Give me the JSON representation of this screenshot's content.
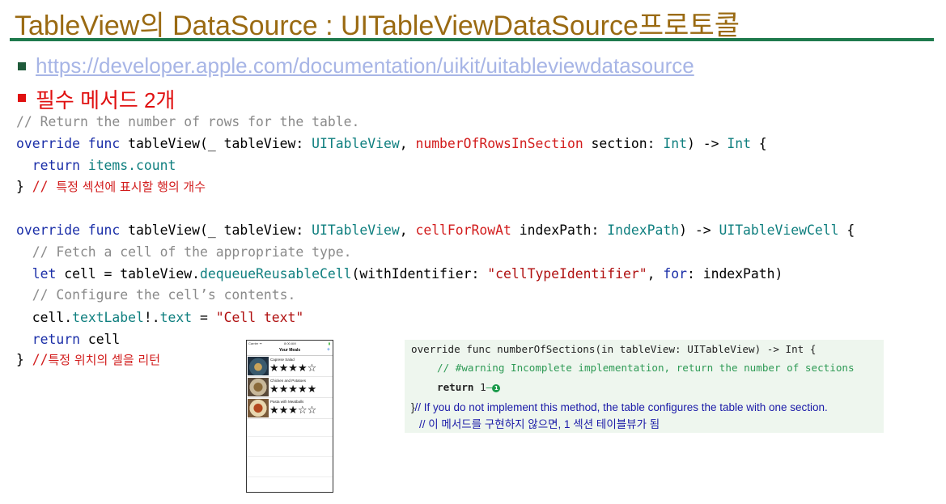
{
  "title": "TableView의 DataSource : UITableViewDataSource프로토콜",
  "colors": {
    "title": "#9a6a12",
    "rule": "#1f7a4d",
    "bullet_green": "#1f5a3a",
    "bullet_red": "#e01010"
  },
  "bullets": {
    "url": "https://developer.apple.com/documentation/uikit/uitableviewdatasource",
    "must": "필수 메서드 2개"
  },
  "code1": {
    "comment": "// Return the number of rows for the table.",
    "l2_a": "override func",
    "l2_b": " tableView(_ tableView: ",
    "l2_c": "UITableView",
    "l2_d": ", ",
    "l2_e": "numberOfRowsInSection",
    "l2_f": " section: ",
    "l2_g": "Int",
    "l2_h": ") -> ",
    "l2_i": "Int",
    "l2_j": " {",
    "l3_a": "  return",
    "l3_b": " items.count",
    "l4_a": "} ",
    "l4_b": "// ",
    "l4_c": "특정 섹션에 표시할 행의 개수"
  },
  "code2": {
    "l1_a": "override func",
    "l1_b": " tableView(_ tableView: ",
    "l1_c": "UITableView",
    "l1_d": ", ",
    "l1_e": "cellForRowAt",
    "l1_f": " indexPath: ",
    "l1_g": "IndexPath",
    "l1_h": ") -> ",
    "l1_i": "UITableViewCell",
    "l1_j": " {",
    "l2": "  // Fetch a cell of the appropriate type.",
    "l3_a": "  let",
    "l3_b": " cell = tableView.",
    "l3_c": "dequeueReusableCell",
    "l3_d": "(withIdentifier: ",
    "l3_e": "\"cellTypeIdentifier\"",
    "l3_f": ", ",
    "l3_g": "for",
    "l3_h": ": indexPath)",
    "l4": "  // Configure the cell’s contents.",
    "l5_a": "  cell.",
    "l5_b": "textLabel",
    "l5_c": "!.",
    "l5_d": "text",
    "l5_e": " = ",
    "l5_f": "\"Cell text\"",
    "l6_a": "  return",
    "l6_b": " cell",
    "l7_a": "} ",
    "l7_b": "//",
    "l7_c": "특정 위치의 셀을 리턴"
  },
  "phone": {
    "carrier": "Carrier ᯤ",
    "time": "8:00 AM",
    "battery": "▮",
    "nav_title": "Your Meals",
    "add": "+",
    "meals": [
      {
        "name": "Caprese Salad",
        "rating": 4,
        "stars": "★★★★☆"
      },
      {
        "name": "Chicken and Potatoes",
        "rating": 5,
        "stars": "★★★★★"
      },
      {
        "name": "Pasta with Meatballs",
        "rating": 3,
        "stars": "★★★☆☆"
      }
    ]
  },
  "snippet": {
    "line1": "override func numberOfSections(in tableView: UITableView) -> Int {",
    "line2": "// #warning Incomplete implementation, return the number of sections",
    "line3_kw": "return",
    "line3_val": " 1",
    "badge": "1",
    "note_brace": "}",
    "note1": "// If you do not implement this method, the table configures the table with one section.",
    "note2": "// 이 메서드를 구현하지 않으면, 1 섹션 테이블뷰가 됨"
  }
}
